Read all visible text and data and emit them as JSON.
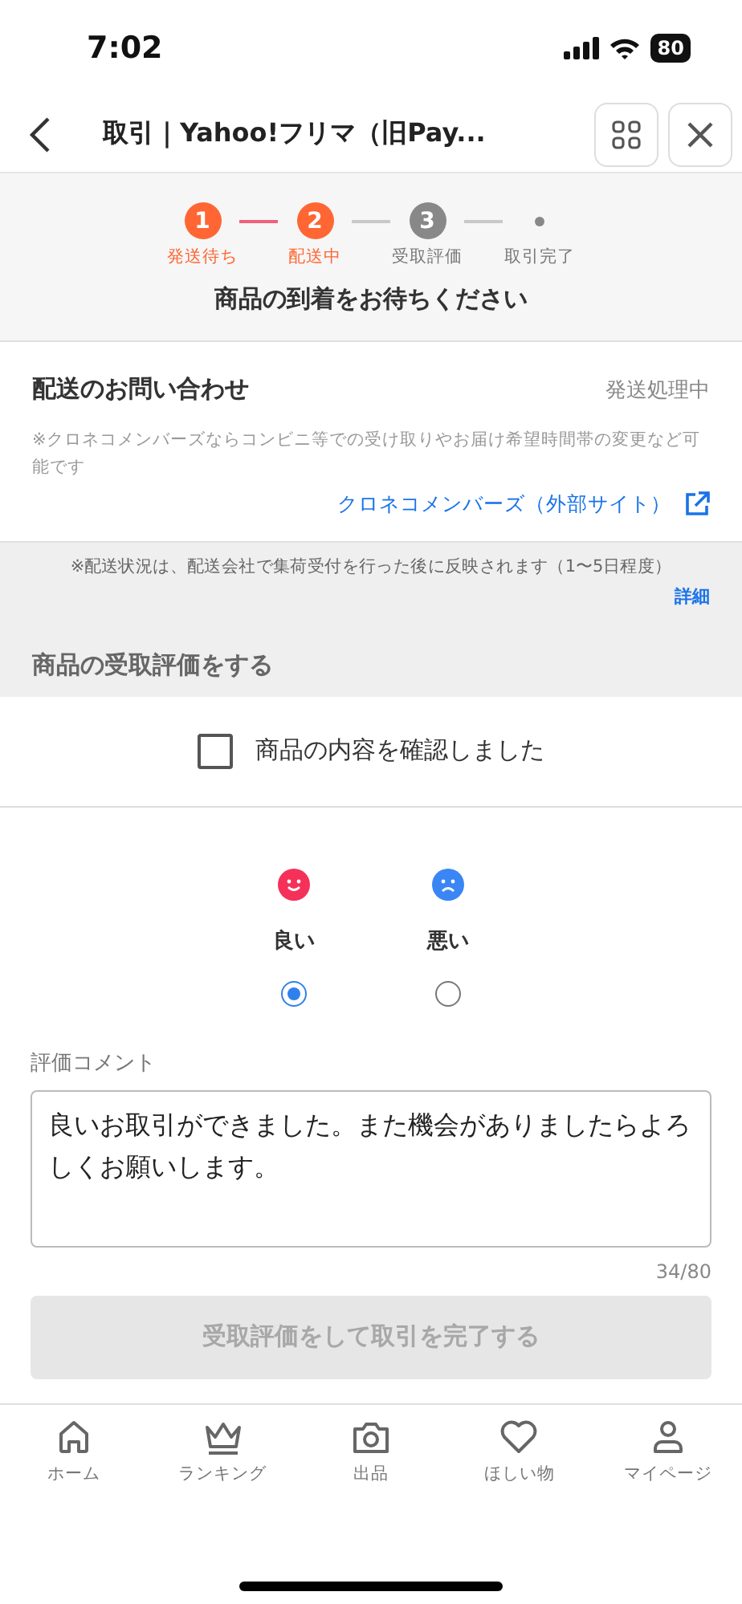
{
  "status_bar": {
    "time": "7:02",
    "battery": "80"
  },
  "nav": {
    "title": "取引｜Yahoo!フリマ（旧Pay..."
  },
  "progress": {
    "steps": [
      {
        "number": "1",
        "label": "発送待ち",
        "reached": true
      },
      {
        "number": "2",
        "label": "配送中",
        "reached": true
      },
      {
        "number": "3",
        "label": "受取評価",
        "reached": false
      },
      {
        "label": "取引完了",
        "reached": false
      }
    ],
    "message": "商品の到着をお待ちください"
  },
  "delivery": {
    "title": "配送のお問い合わせ",
    "status": "発送処理中",
    "note": "※クロネコメンバーズならコンビニ等での受け取りやお届け希望時間帯の変更など可能です",
    "link": "クロネコメンバーズ（外部サイト）"
  },
  "delivery_notice": {
    "text": "※配送状況は、配送会社で集荷受付を行った後に反映されます（1〜5日程度）",
    "link": "詳細"
  },
  "review": {
    "heading": "商品の受取評価をする",
    "confirm": {
      "label": "商品の内容を確認しました",
      "checked": false
    },
    "options": [
      {
        "kind": "good",
        "label": "良い",
        "selected": true
      },
      {
        "kind": "bad",
        "label": "悪い",
        "selected": false
      }
    ],
    "comment_label": "評価コメント",
    "comment": "良いお取引ができました。また機会がありましたらよろしくお願いします。",
    "counter": "34/80",
    "submit": {
      "label": "受取評価をして取引を完了する",
      "disabled": true
    }
  },
  "tab_bar": [
    {
      "kind": "home",
      "label": "ホーム"
    },
    {
      "kind": "ranking",
      "label": "ランキング"
    },
    {
      "kind": "sell",
      "label": "出品"
    },
    {
      "kind": "wish",
      "label": "ほしい物"
    },
    {
      "kind": "mypage",
      "label": "マイページ"
    }
  ]
}
